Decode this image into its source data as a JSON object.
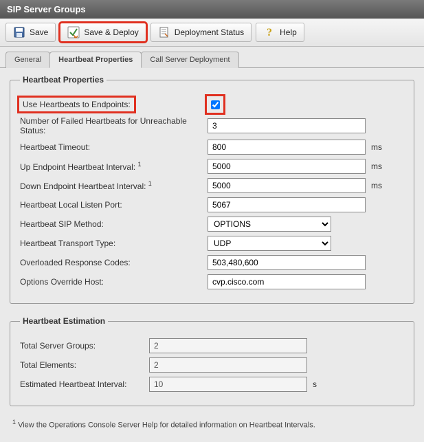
{
  "title": "SIP Server Groups",
  "toolbar": {
    "save": "Save",
    "save_deploy": "Save & Deploy",
    "deployment_status": "Deployment Status",
    "help": "Help"
  },
  "tabs": {
    "general": "General",
    "heartbeat": "Heartbeat Properties",
    "call_server": "Call Server Deployment"
  },
  "heartbeat": {
    "legend": "Heartbeat Properties",
    "use_heartbeats_label": "Use Heartbeats to Endpoints:",
    "use_heartbeats_checked": true,
    "failed_label": "Number of Failed Heartbeats for Unreachable Status:",
    "failed_value": "3",
    "timeout_label": "Heartbeat Timeout:",
    "timeout_value": "800",
    "up_interval_label": "Up Endpoint Heartbeat Interval:",
    "up_interval_value": "5000",
    "down_interval_label": "Down Endpoint Heartbeat Interval:",
    "down_interval_value": "5000",
    "listen_port_label": "Heartbeat Local Listen Port:",
    "listen_port_value": "5067",
    "sip_method_label": "Heartbeat SIP Method:",
    "sip_method_value": "OPTIONS",
    "transport_label": "Heartbeat Transport Type:",
    "transport_value": "UDP",
    "overloaded_label": "Overloaded Response Codes:",
    "overloaded_value": "503,480,600",
    "override_host_label": "Options Override Host:",
    "override_host_value": "cvp.cisco.com",
    "ms": "ms",
    "s": "s",
    "footnote_marker": "1"
  },
  "estimation": {
    "legend": "Heartbeat Estimation",
    "total_groups_label": "Total Server Groups:",
    "total_groups_value": "2",
    "total_elements_label": "Total Elements:",
    "total_elements_value": "2",
    "est_interval_label": "Estimated Heartbeat Interval:",
    "est_interval_value": "10"
  },
  "footnote": "View the Operations Console Server Help for detailed information on Heartbeat Intervals."
}
